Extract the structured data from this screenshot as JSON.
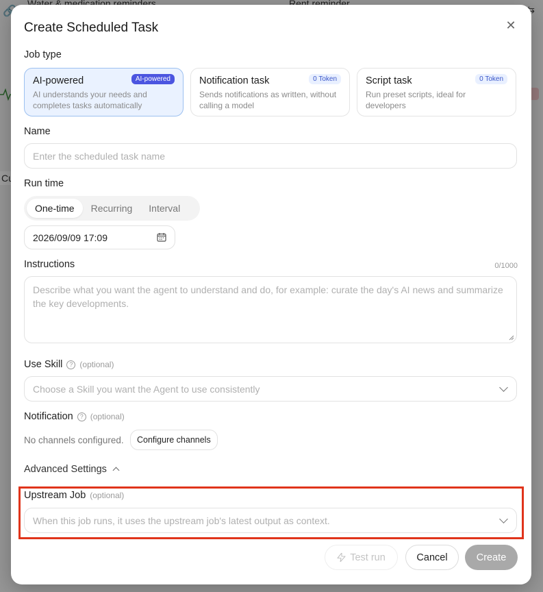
{
  "background": {
    "card_left_title": "Water & medication reminders",
    "card_right_title": "Rent reminder",
    "partial_text": "Cur"
  },
  "modal": {
    "title": "Create Scheduled Task",
    "close_icon": "close-icon"
  },
  "job_type": {
    "label": "Job type",
    "options": [
      {
        "title": "AI-powered",
        "badge": "AI-powered",
        "desc": "AI understands your needs and completes tasks automatically",
        "selected": true
      },
      {
        "title": "Notification task",
        "badge": "0 Token",
        "desc": "Sends notifications as written, without calling a model",
        "selected": false
      },
      {
        "title": "Script task",
        "badge": "0 Token",
        "desc": "Run preset scripts, ideal for developers",
        "selected": false
      }
    ]
  },
  "name": {
    "label": "Name",
    "placeholder": "Enter the scheduled task name"
  },
  "run_time": {
    "label": "Run time",
    "modes": [
      "One-time",
      "Recurring",
      "Interval"
    ],
    "active_mode": "One-time",
    "datetime": "2026/09/09 17:09"
  },
  "instructions": {
    "label": "Instructions",
    "counter": "0/1000",
    "placeholder": "Describe what you want the agent to understand and do, for example: curate the day's AI news and summarize the key developments."
  },
  "use_skill": {
    "label": "Use Skill",
    "optional": "(optional)",
    "placeholder": "Choose a Skill you want the Agent to use consistently"
  },
  "notification": {
    "label": "Notification",
    "optional": "(optional)",
    "status": "No channels configured.",
    "configure_label": "Configure channels"
  },
  "advanced": {
    "label": "Advanced Settings"
  },
  "upstream": {
    "label": "Upstream Job",
    "optional": "(optional)",
    "placeholder": "When this job runs, it uses the upstream job's latest output as context."
  },
  "footer": {
    "test_run": "Test run",
    "cancel": "Cancel",
    "create": "Create"
  },
  "colors": {
    "accent": "#4b55e0",
    "highlight": "#e0341b",
    "create_disabled": "#a9a9a9"
  }
}
